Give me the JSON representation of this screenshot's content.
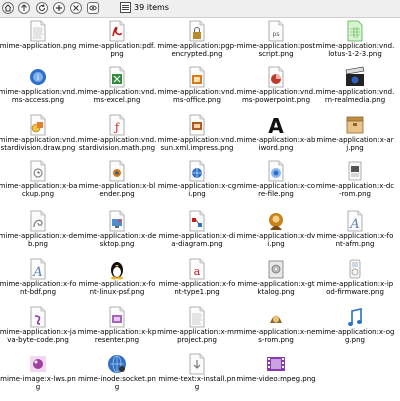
{
  "toolbar": {
    "buttons": [
      {
        "name": "home-icon"
      },
      {
        "name": "up-icon"
      },
      {
        "name": "reload-icon"
      },
      {
        "name": "new-icon"
      },
      {
        "name": "delete-icon"
      },
      {
        "name": "eye-icon"
      }
    ],
    "view_icon": "grid-view-icon",
    "item_count": "39 items"
  },
  "items": [
    {
      "label": "mime-application.png",
      "icon": "doc",
      "color": "#7a7a7a"
    },
    {
      "label": "mime-application:pdf.png",
      "icon": "pdf",
      "color": "#c01818"
    },
    {
      "label": "mime-application:pgp-encrypted.png",
      "icon": "pgp",
      "color": "#b88a2a"
    },
    {
      "label": "mime-application:postscript.png",
      "icon": "ps",
      "color": "#555555"
    },
    {
      "label": "mime-application:vnd.lotus-1-2-3.png",
      "icon": "sheet",
      "color": "#4caf50"
    },
    {
      "label": "mime-application:vnd.ms-access.png",
      "icon": "access",
      "color": "#2a6fc9"
    },
    {
      "label": "mime-application:vnd.ms-excel.png",
      "icon": "excel",
      "color": "#2e8b3a"
    },
    {
      "label": "mime-application:vnd.ms-office.png",
      "icon": "office",
      "color": "#d87a1a"
    },
    {
      "label": "mime-application:vnd.ms-powerpoint.png",
      "icon": "ppt",
      "color": "#c0392b"
    },
    {
      "label": "mime-application:vnd.rn-realmedia.png",
      "icon": "clapper",
      "color": "#3060c0"
    },
    {
      "label": "mime-application:vnd.stardivision.draw.png",
      "icon": "draw",
      "color": "#a06a10"
    },
    {
      "label": "mime-application:vnd.stardivision.math.png",
      "icon": "math",
      "color": "#c02020"
    },
    {
      "label": "mime-application:vnd.sun.xml.impress.png",
      "icon": "impress",
      "color": "#b05a20"
    },
    {
      "label": "mime-application:x-abiword.png",
      "icon": "letterA",
      "color": "#111111"
    },
    {
      "label": "mime-application:x-arj.png",
      "icon": "archive",
      "color": "#c08a40"
    },
    {
      "label": "mime-application:x-backup.png",
      "icon": "backup",
      "color": "#888888"
    },
    {
      "label": "mime-application:x-blender.png",
      "icon": "blender",
      "color": "#e07a10"
    },
    {
      "label": "mime-application:x-cgi.png",
      "icon": "cgi",
      "color": "#2a6fc9"
    },
    {
      "label": "mime-application:x-core-file.png",
      "icon": "core",
      "color": "#2a6fc9"
    },
    {
      "label": "mime-application:x-dc-rom.png",
      "icon": "rom",
      "color": "#555555"
    },
    {
      "label": "mime-application:x-deb.png",
      "icon": "deb",
      "color": "#888888"
    },
    {
      "label": "mime-application:x-desktop.png",
      "icon": "desktop",
      "color": "#4c8fd0"
    },
    {
      "label": "mime-application:x-dia-diagram.png",
      "icon": "dia",
      "color": "#c02020"
    },
    {
      "label": "mime-application:x-dvi.png",
      "icon": "dvi",
      "color": "#c8821a"
    },
    {
      "label": "mime-application:x-font-afm.png",
      "icon": "fontA",
      "color": "#5a7fb0"
    },
    {
      "label": "mime-application:x-font-bdf.png",
      "icon": "fontA",
      "color": "#5a7fb0"
    },
    {
      "label": "mime-application:x-font-linux-psf.png",
      "icon": "tux",
      "color": "#111111"
    },
    {
      "label": "mime-application:x-font-type1.png",
      "icon": "fontType1",
      "color": "#c02020"
    },
    {
      "label": "mime-application:x-gtktalog.png",
      "icon": "gtktalog",
      "color": "#777777"
    },
    {
      "label": "mime-application:x-ipod-firmware.png",
      "icon": "ipod",
      "color": "#999999"
    },
    {
      "label": "mime-application:x-java-byte-code.png",
      "icon": "java",
      "color": "#8a3ab0"
    },
    {
      "label": "mime-application:x-kpresenter.png",
      "icon": "kpresenter",
      "color": "#9040b0"
    },
    {
      "label": "mime-application:x-mrproject.png",
      "icon": "doc",
      "color": "#7a7a7a"
    },
    {
      "label": "mime-application:x-nes-rom.png",
      "icon": "nes",
      "color": "#8a6a3a"
    },
    {
      "label": "mime-application:x-ogg.png",
      "icon": "ogg",
      "color": "#2a6fc9"
    },
    {
      "label": "mime-image:x-lws.png",
      "icon": "lws",
      "color": "#a040a0"
    },
    {
      "label": "mime-inode:socket.png",
      "icon": "socket",
      "color": "#3070c0"
    },
    {
      "label": "mime-text:x-install.png",
      "icon": "install",
      "color": "#777777"
    },
    {
      "label": "mime-video:mpeg.png",
      "icon": "film",
      "color": "#8a3ab0"
    }
  ]
}
